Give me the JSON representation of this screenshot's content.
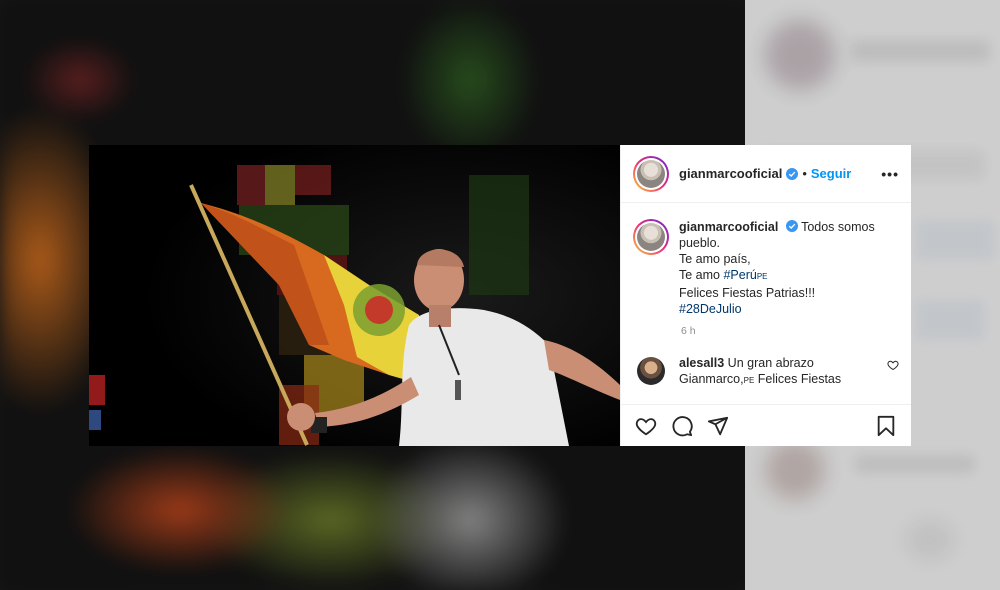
{
  "post": {
    "username": "gianmarcooficial",
    "separator": "•",
    "follow_label": "Seguir",
    "more_label": "•••",
    "caption": {
      "username": "gianmarcooficial",
      "line1": "Todos somos pueblo.",
      "line2": "Te amo país,",
      "line3_prefix": "Te amo ",
      "hashtag1": "#Perú",
      "flag1": "PE",
      "line4": "Felices Fiestas Patrias!!!",
      "hashtag2": "#28DeJulio"
    },
    "time": "6 h",
    "comments": [
      {
        "username": "alesall3",
        "text_part1": "Un gran abrazo Gianmarco,",
        "flag": "PE",
        "text_part2": "Felices Fiestas"
      }
    ]
  },
  "icons": {
    "verified": "verified-badge-icon",
    "like": "heart-icon",
    "comment": "comment-bubble-icon",
    "share": "paper-plane-icon",
    "save": "bookmark-icon",
    "comment_like": "small-heart-icon"
  },
  "colors": {
    "follow_blue": "#0095f6",
    "hashtag": "#00376b",
    "text": "#262626",
    "muted": "#8e8e8e"
  }
}
